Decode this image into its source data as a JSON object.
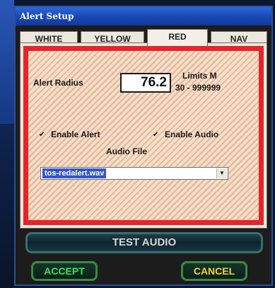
{
  "window": {
    "title": "Alert Setup"
  },
  "tabs": [
    {
      "label": "WHITE"
    },
    {
      "label": "YELLOW"
    },
    {
      "label": "RED",
      "active": true
    },
    {
      "label": "NAV"
    }
  ],
  "alert": {
    "radius_label": "Alert Radius",
    "radius_value": "76.2",
    "limits_label": "Limits M",
    "limits_range": "30 - 999999",
    "enable_alert_label": "Enable Alert",
    "enable_alert_checked": true,
    "enable_audio_label": "Enable Audio",
    "enable_audio_checked": true,
    "audio_file_label": "Audio File",
    "audio_file_value": "tos-redalert.wav"
  },
  "buttons": {
    "test_audio": "TEST AUDIO",
    "accept": "ACCEPT",
    "cancel": "CANCEL"
  },
  "colors": {
    "alert_border": "#e8232a",
    "accept_text": "#39e05a",
    "cancel_text": "#f0d23a",
    "title_bar": "#1846b4"
  },
  "icons": {
    "checkbox_check": "check-icon",
    "select_arrow": "chevron-down-icon"
  }
}
